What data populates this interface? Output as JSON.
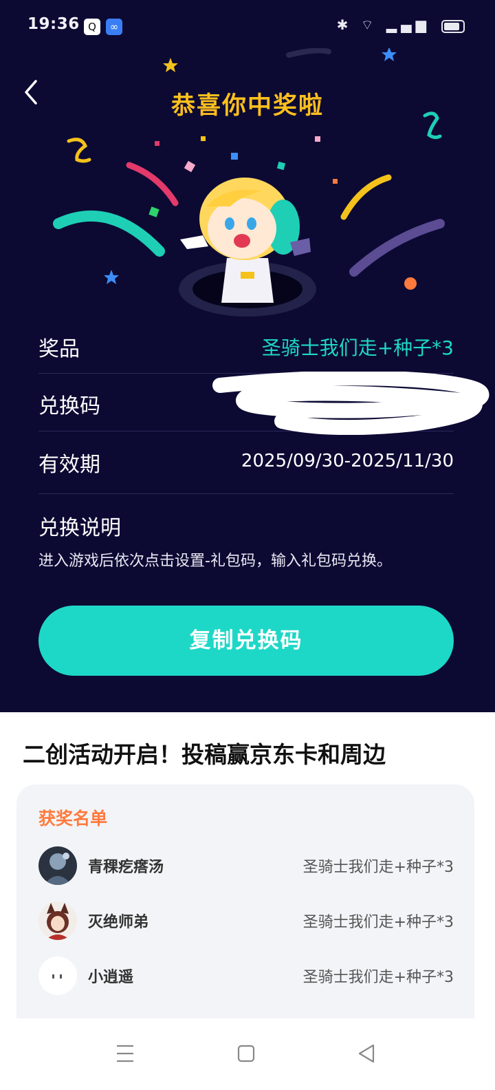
{
  "status": {
    "time": "19:36",
    "app1": "Q",
    "app2": "∞"
  },
  "header": {
    "title": "恭喜你中奖啦"
  },
  "rows": [
    {
      "label": "奖品",
      "value": "圣骑士我们走+种子*3"
    },
    {
      "label": "兑换码",
      "value": ""
    },
    {
      "label": "有效期",
      "value": "2025/09/30-2025/11/30"
    }
  ],
  "instructions": {
    "title": "兑换说明",
    "text": "进入游戏后依次点击设置-礼包码，输入礼包码兑换。"
  },
  "copy_button": "复制兑换码",
  "section_title": "二创活动开启！投稿赢京东卡和周边",
  "winners": {
    "title": "获奖名单",
    "list": [
      {
        "name": "青稞疙瘩汤",
        "prize": "圣骑士我们走+种子*3",
        "avatar": "avatar-dark-character-icon"
      },
      {
        "name": "灭绝师弟",
        "prize": "圣骑士我们走+种子*3",
        "avatar": "avatar-fox-girl-icon"
      },
      {
        "name": "小逍遥",
        "prize": "圣骑士我们走+种子*3",
        "avatar": "avatar-white-face-icon"
      }
    ]
  },
  "colors": {
    "hero_bg": "#0c0a33",
    "accent_teal": "#1ed8c7",
    "title_gold": "#ffbf1e",
    "winners_title": "#ff7a3d"
  }
}
